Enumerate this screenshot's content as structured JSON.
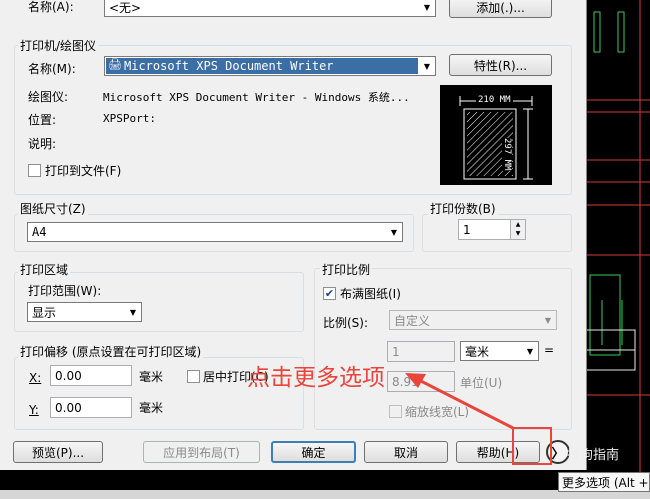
{
  "page_setup": {
    "name_label": "名称(A):",
    "name_value": "<无>",
    "add_button": "添加(.)..."
  },
  "printer": {
    "group_label": "打印机/绘图仪",
    "name_label": "名称(M):",
    "name_value": "Microsoft XPS Document Writer",
    "properties_button": "特性(R)...",
    "plotter_label": "绘图仪:",
    "plotter_value": "Microsoft XPS Document Writer - Windows 系统...",
    "location_label": "位置:",
    "location_value": "XPSPort:",
    "description_label": "说明:",
    "print_to_file_label": "打印到文件(F)",
    "paper_width_label": "210 MM",
    "paper_height_label": "297 MM"
  },
  "paper_size": {
    "label": "图纸尺寸(Z)",
    "value": "A4"
  },
  "copies": {
    "label": "打印份数(B)",
    "value": "1"
  },
  "plot_area": {
    "label": "打印区域",
    "range_label": "打印范围(W):",
    "range_value": "显示"
  },
  "plot_offset": {
    "label": "打印偏移 (原点设置在可打印区域)",
    "x_label": "X:",
    "x_value": "0.00",
    "x_unit": "毫米",
    "y_label": "Y:",
    "y_value": "0.00",
    "y_unit": "毫米",
    "center_label": "居中打印(C)"
  },
  "plot_scale": {
    "label": "打印比例",
    "fit_label": "布满图纸(I)",
    "fit_checked": "✔",
    "scale_label": "比例(S):",
    "scale_value": "自定义",
    "value1": "1",
    "unit_value": "毫米",
    "equals": "=",
    "value2": "8.91",
    "unit_label": "单位(U)",
    "lineweight_label": "缩放线宽(L)"
  },
  "buttons": {
    "preview": "预览(P)...",
    "apply_layout": "应用到布局(T)",
    "ok": "确定",
    "cancel": "取消",
    "help": "帮助(H)",
    "more": "〉"
  },
  "annotation": "点击更多选项",
  "watermark": "搜狗指南",
  "tooltip": "更多选项 (Alt +"
}
